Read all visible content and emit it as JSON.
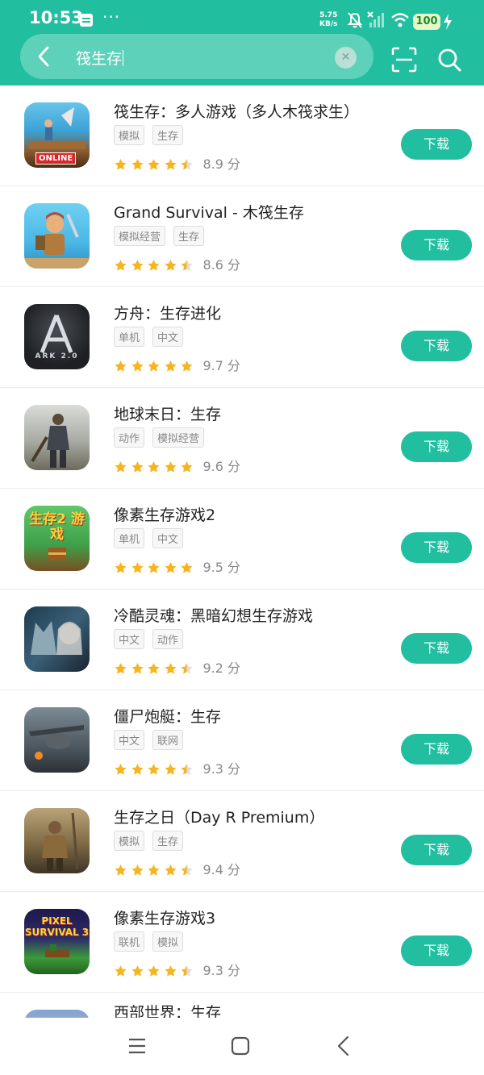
{
  "status_bar": {
    "time": "10:53",
    "overflow": "···",
    "net_speed_value": "5.75",
    "net_speed_unit": "KB/s",
    "battery": "100"
  },
  "search": {
    "query": "筏生存"
  },
  "download_label": "下载",
  "score_unit": "分",
  "colors": {
    "accent": "#21bea0",
    "star": "#f6b51e"
  },
  "apps": [
    {
      "title": "筏生存：多人游戏（多人木筏求生）",
      "tags": [
        "模拟",
        "生存"
      ],
      "score": "8.9",
      "stars": 4.5,
      "icon_badge": "ONLINE"
    },
    {
      "title": "Grand Survival - 木筏生存",
      "tags": [
        "模拟经营",
        "生存"
      ],
      "score": "8.6",
      "stars": 4.5
    },
    {
      "title": "方舟：生存进化",
      "tags": [
        "单机",
        "中文"
      ],
      "score": "9.7",
      "stars": 5,
      "icon_badge": "ARK 2.0"
    },
    {
      "title": "地球末日：生存",
      "tags": [
        "动作",
        "模拟经营"
      ],
      "score": "9.6",
      "stars": 5
    },
    {
      "title": "像素生存游戏2",
      "tags": [
        "单机",
        "中文"
      ],
      "score": "9.5",
      "stars": 5,
      "icon_badge": "生存2 游戏"
    },
    {
      "title": "冷酷灵魂：黑暗幻想生存游戏",
      "tags": [
        "中文",
        "动作"
      ],
      "score": "9.2",
      "stars": 4.5
    },
    {
      "title": "僵尸炮艇：生存",
      "tags": [
        "中文",
        "联网"
      ],
      "score": "9.3",
      "stars": 4.5
    },
    {
      "title": "生存之日（Day R Premium）",
      "tags": [
        "模拟",
        "生存"
      ],
      "score": "9.4",
      "stars": 4.5
    },
    {
      "title": "像素生存游戏3",
      "tags": [
        "联机",
        "模拟"
      ],
      "score": "9.3",
      "stars": 4.5,
      "icon_badge": "PIXEL SURVIVAL 3"
    }
  ],
  "partial_app": {
    "title": "西部世界：生存"
  }
}
